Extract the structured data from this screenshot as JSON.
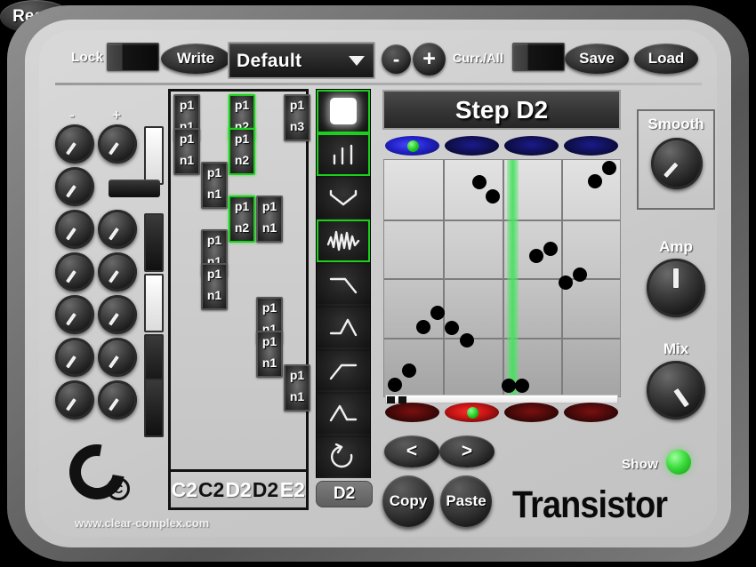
{
  "toolbar": {
    "lock_label": "Lock",
    "lock_state": "off",
    "write_label": "Write",
    "preset_name": "Default",
    "preset_chevron_icon": "chevron-down-icon",
    "minus_label": "-",
    "plus_label": "+",
    "currall_label": "Curr./All",
    "currall_state": "off",
    "save_label": "Save",
    "load_label": "Load"
  },
  "knob_bank": {
    "minus_label": "-",
    "plus_label": "+",
    "knobs": [
      {
        "col": "minus",
        "row": 0,
        "angle": 215
      },
      {
        "col": "plus",
        "row": 0,
        "angle": 215
      },
      {
        "col": "minus",
        "row": 1,
        "angle": 215
      },
      {
        "col": "minus",
        "row": 2,
        "angle": 215
      },
      {
        "col": "plus",
        "row": 2,
        "angle": 215
      },
      {
        "col": "minus",
        "row": 3,
        "angle": 215
      },
      {
        "col": "plus",
        "row": 3,
        "angle": 215
      },
      {
        "col": "minus",
        "row": 4,
        "angle": 215
      },
      {
        "col": "plus",
        "row": 4,
        "angle": 215
      },
      {
        "col": "minus",
        "row": 5,
        "angle": 215
      },
      {
        "col": "plus",
        "row": 5,
        "angle": 215
      },
      {
        "col": "minus",
        "row": 6,
        "angle": 215
      },
      {
        "col": "plus",
        "row": 6,
        "angle": 215
      }
    ],
    "strips": [
      {
        "type": "vertical",
        "state": "on"
      },
      {
        "type": "horizontal",
        "state": "off"
      },
      {
        "type": "vertical",
        "state": "off"
      },
      {
        "type": "vertical",
        "state": "on"
      },
      {
        "type": "vertical",
        "state": "off"
      },
      {
        "type": "vertical",
        "state": "on"
      },
      {
        "type": "vertical",
        "state": "off"
      }
    ]
  },
  "logo": {
    "copyright_glyph": "C",
    "site_url": "www.clear-complex.com"
  },
  "matrix": {
    "columns": 5,
    "rows": 11,
    "cells": [
      {
        "col": 0,
        "row": 0,
        "top": "p1",
        "bottom": "n1",
        "selected": false
      },
      {
        "col": 2,
        "row": 0,
        "top": "p1",
        "bottom": "n2",
        "selected": true
      },
      {
        "col": 4,
        "row": 0,
        "top": "p1",
        "bottom": "n3",
        "selected": false
      },
      {
        "col": 0,
        "row": 1,
        "top": "p1",
        "bottom": "n1",
        "selected": false
      },
      {
        "col": 2,
        "row": 1,
        "top": "p1",
        "bottom": "n2",
        "selected": true
      },
      {
        "col": 1,
        "row": 2,
        "top": "p1",
        "bottom": "n1",
        "selected": false
      },
      {
        "col": 2,
        "row": 3,
        "top": "p1",
        "bottom": "n2",
        "selected": true
      },
      {
        "col": 3,
        "row": 3,
        "top": "p1",
        "bottom": "n1",
        "selected": false
      },
      {
        "col": 1,
        "row": 4,
        "top": "p1",
        "bottom": "n1",
        "selected": false
      },
      {
        "col": 1,
        "row": 5,
        "top": "p1",
        "bottom": "n1",
        "selected": false
      },
      {
        "col": 3,
        "row": 6,
        "top": "p1",
        "bottom": "n1",
        "selected": false
      },
      {
        "col": 3,
        "row": 7,
        "top": "p1",
        "bottom": "n1",
        "selected": false
      },
      {
        "col": 4,
        "row": 8,
        "top": "p1",
        "bottom": "n1",
        "selected": false
      }
    ],
    "notes": [
      {
        "label": "C2",
        "style": "white"
      },
      {
        "label": "C2",
        "style": "black"
      },
      {
        "label": "D2",
        "style": "white"
      },
      {
        "label": "D2",
        "style": "black"
      },
      {
        "label": "E2",
        "style": "white"
      }
    ]
  },
  "mode_column": {
    "buttons": [
      {
        "icon": "white-square-icon",
        "active": true
      },
      {
        "icon": "bars-icon",
        "active": true
      },
      {
        "icon": "v-shape-icon",
        "active": false
      },
      {
        "icon": "noise-waveform-icon",
        "active": true
      },
      {
        "icon": "falling-ramp-icon",
        "active": false
      },
      {
        "icon": "peak-up-icon",
        "active": false
      },
      {
        "icon": "rising-ramp-icon",
        "active": false
      },
      {
        "icon": "triangle-peak-icon",
        "active": false
      },
      {
        "icon": "undo-arrow-icon",
        "active": false
      }
    ]
  },
  "step_pill_label": "D2",
  "display": {
    "title": "Step D2"
  },
  "leds": {
    "top": [
      {
        "color": "blue",
        "on": true
      },
      {
        "color": "blue",
        "on": false
      },
      {
        "color": "blue",
        "on": false
      },
      {
        "color": "blue",
        "on": false
      }
    ],
    "bottom": [
      {
        "color": "red",
        "on": false
      },
      {
        "color": "red",
        "on": true
      },
      {
        "color": "red",
        "on": false
      },
      {
        "color": "red",
        "on": false
      }
    ]
  },
  "chart_data": {
    "type": "scatter",
    "title": "Step D2",
    "xlabel": "",
    "ylabel": "",
    "xlim": [
      0,
      1
    ],
    "ylim": [
      0,
      1
    ],
    "grid": true,
    "grid_divisions": 4,
    "playhead_x": 0.545,
    "points": [
      {
        "x": 0.405,
        "y": 0.905
      },
      {
        "x": 0.46,
        "y": 0.845
      },
      {
        "x": 0.895,
        "y": 0.91
      },
      {
        "x": 0.955,
        "y": 0.965
      },
      {
        "x": 0.645,
        "y": 0.595
      },
      {
        "x": 0.705,
        "y": 0.625
      },
      {
        "x": 0.77,
        "y": 0.48
      },
      {
        "x": 0.83,
        "y": 0.515
      },
      {
        "x": 0.225,
        "y": 0.355
      },
      {
        "x": 0.165,
        "y": 0.295
      },
      {
        "x": 0.285,
        "y": 0.29
      },
      {
        "x": 0.35,
        "y": 0.235
      },
      {
        "x": 0.105,
        "y": 0.11
      },
      {
        "x": 0.045,
        "y": 0.05
      },
      {
        "x": 0.53,
        "y": 0.045
      },
      {
        "x": 0.585,
        "y": 0.045
      }
    ]
  },
  "scrollbar": {
    "handles": 2
  },
  "transport": {
    "prev_label": "<",
    "next_label": ">",
    "reset_label": "Reset",
    "copy_label": "Copy",
    "paste_label": "Paste"
  },
  "brand": "Transistor",
  "right_knobs": {
    "smooth": {
      "label": "Smooth",
      "angle": 222
    },
    "amp": {
      "label": "Amp",
      "angle": 0
    },
    "mix": {
      "label": "Mix",
      "angle": 145
    }
  },
  "show": {
    "label": "Show",
    "led_color": "#3ddc3d",
    "on": true
  }
}
